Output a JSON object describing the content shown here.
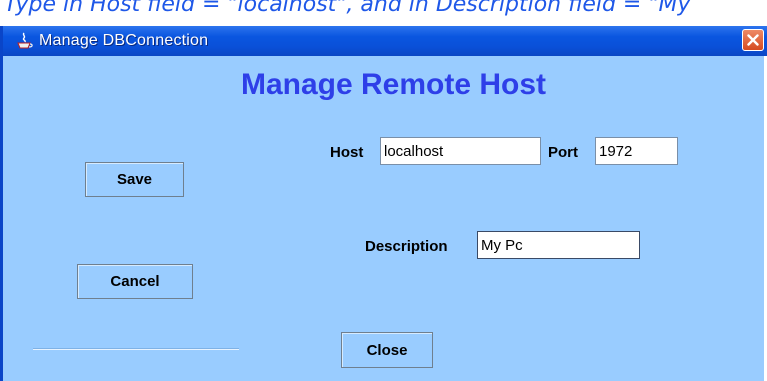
{
  "caption": "Type in Host field = \"localhost\", and in Description field = \"My",
  "window": {
    "title": "Manage DBConnection"
  },
  "dialog": {
    "heading": "Manage Remote Host",
    "host_label": "Host",
    "host_value": "localhost",
    "port_label": "Port",
    "port_value": "1972",
    "description_label": "Description",
    "description_value": "My Pc",
    "save_label": "Save",
    "cancel_label": "Cancel",
    "close_label": "Close"
  },
  "colors": {
    "client_bg": "#99ccff",
    "heading": "#2e3fe8",
    "titlebar": "#0a50d8",
    "caption_text": "#1f58e8"
  }
}
